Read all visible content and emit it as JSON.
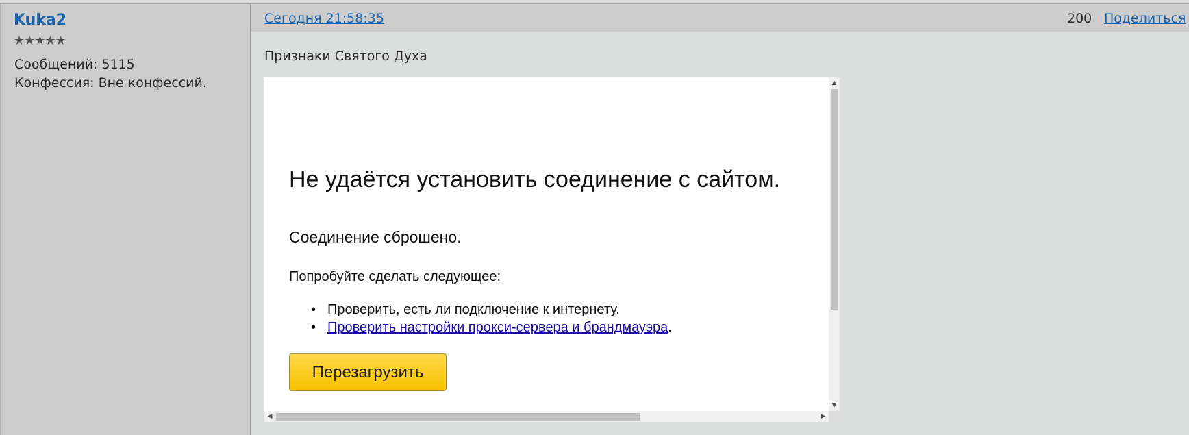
{
  "author": {
    "name": "Kuka2",
    "stars": "★★★★★",
    "posts_label": "Сообщений: 5115",
    "confession_label": "Конфессия: Вне конфессий."
  },
  "post": {
    "date": "Сегодня 21:58:35",
    "number": "200",
    "share_label": "Поделиться",
    "title": "Признаки Святого Духа"
  },
  "embed": {
    "heading": "Не удаётся установить соединение с сайтом.",
    "subheading": "Соединение сброшено.",
    "try_label": "Попробуйте сделать следующее:",
    "suggestions": [
      "Проверить, есть ли подключение к интернету.",
      "Проверить настройки прокси-сервера и брандмауэра"
    ],
    "suggestion_suffix": ".",
    "bullet": "•",
    "reload_button": "Перезагрузить",
    "scroll_up": "▲",
    "scroll_down": "▼",
    "scroll_left": "◀",
    "scroll_right": "▶"
  }
}
